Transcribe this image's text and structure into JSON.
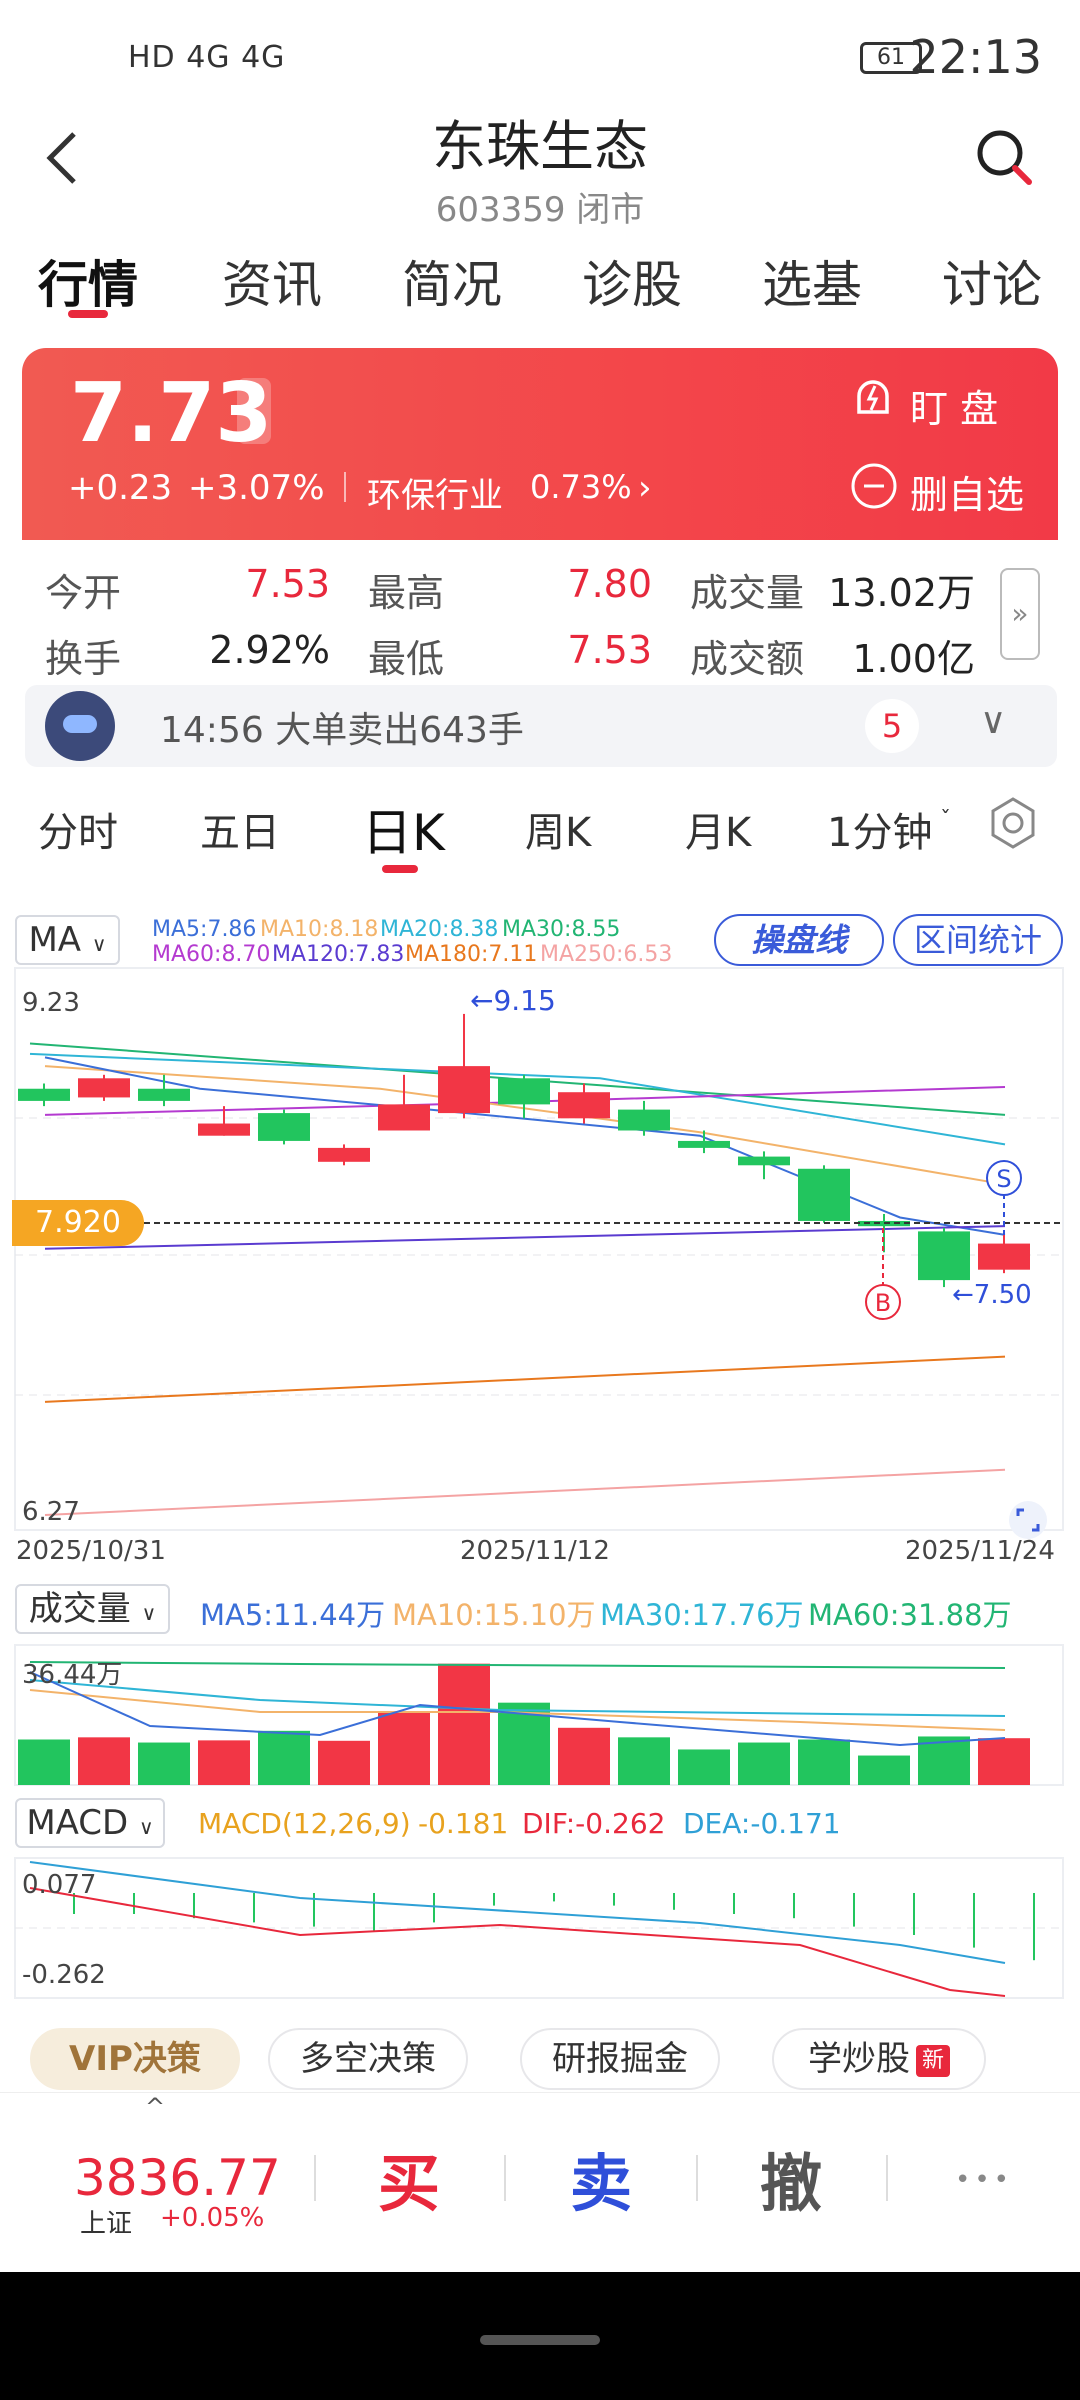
{
  "status_bar": {
    "left": "HD 4G 4G",
    "battery": "61",
    "time": "22:13"
  },
  "header": {
    "title": "东珠生态",
    "subtitle": "603359 闭市"
  },
  "tabs": [
    "行情",
    "资讯",
    "简况",
    "诊股",
    "选基",
    "讨论"
  ],
  "quote": {
    "price": "7.73",
    "change": "+0.23",
    "change_pct": "+3.07%",
    "sector": "环保行业",
    "sector_pct": "0.73%",
    "watch_label": "盯  盘",
    "fav_label": "删自选",
    "open_label": "今开",
    "open": "7.53",
    "high_label": "最高",
    "high": "7.80",
    "volume_label": "成交量",
    "volume": "13.02万",
    "turnover_label": "换手",
    "turnover": "2.92%",
    "low_label": "最低",
    "low": "7.53",
    "amount_label": "成交额",
    "amount": "1.00亿"
  },
  "news": {
    "text": "14:56 大单卖出643手",
    "count": "5"
  },
  "period_tabs": [
    "分时",
    "五日",
    "日K",
    "周K",
    "月K",
    "1分钟"
  ],
  "chart": {
    "indicator_select": "MA",
    "ma_legend": [
      {
        "text": "MA5:7.86",
        "color": "#3b6fd8"
      },
      {
        "text": "MA10:8.18",
        "color": "#f3b36a"
      },
      {
        "text": "MA20:8.38",
        "color": "#2fb5d6"
      },
      {
        "text": "MA30:8.55",
        "color": "#22b573"
      },
      {
        "text": "MA60:8.70",
        "color": "#b43ad0"
      },
      {
        "text": "MA120:7.83",
        "color": "#5a3bd0"
      },
      {
        "text": "MA180:7.11",
        "color": "#e8781e"
      },
      {
        "text": "MA250:6.53",
        "color": "#f4a3a3"
      }
    ],
    "btn_line": "操盘线",
    "btn_stats": "区间统计",
    "y_top": "9.23",
    "y_bottom": "6.27",
    "current_price_tag": "7.920",
    "max_marker": "←9.15",
    "min_marker": "←7.50",
    "buy_marker": "B",
    "sell_marker": "S",
    "dates": [
      "2025/10/31",
      "2025/11/12",
      "2025/11/24"
    ],
    "volume_select": "成交量",
    "volume_legend": [
      {
        "text": "MA5:11.44万",
        "color": "#3b6fd8"
      },
      {
        "text": "MA10:15.10万",
        "color": "#f3b36a"
      },
      {
        "text": "MA30:17.76万",
        "color": "#2fb5d6"
      },
      {
        "text": "MA60:31.88万",
        "color": "#22b573"
      }
    ],
    "volume_top": "36.44万",
    "macd_select": "MACD",
    "macd_legend": [
      {
        "text": "MACD(12,26,9)",
        "color": "#e8a21e"
      },
      {
        "text": "-0.181",
        "color": "#e8a21e"
      },
      {
        "text": "DIF:-0.262",
        "color": "#e8283c"
      },
      {
        "text": "DEA:-0.171",
        "color": "#2fa0d6"
      }
    ],
    "macd_top": "0.077",
    "macd_bottom": "-0.262"
  },
  "chart_data": {
    "type": "candlestick",
    "candles": [
      {
        "open": 8.72,
        "close": 8.65,
        "high": 8.75,
        "low": 8.62
      },
      {
        "open": 8.67,
        "close": 8.78,
        "high": 8.8,
        "low": 8.65
      },
      {
        "open": 8.72,
        "close": 8.65,
        "high": 8.8,
        "low": 8.62
      },
      {
        "open": 8.45,
        "close": 8.52,
        "high": 8.62,
        "low": 8.45
      },
      {
        "open": 8.58,
        "close": 8.42,
        "high": 8.6,
        "low": 8.4
      },
      {
        "open": 8.3,
        "close": 8.38,
        "high": 8.4,
        "low": 8.28
      },
      {
        "open": 8.48,
        "close": 8.63,
        "high": 8.8,
        "low": 8.48
      },
      {
        "open": 8.58,
        "close": 8.85,
        "high": 9.15,
        "low": 8.55
      },
      {
        "open": 8.78,
        "close": 8.63,
        "high": 8.8,
        "low": 8.55
      },
      {
        "open": 8.55,
        "close": 8.7,
        "high": 8.75,
        "low": 8.52
      },
      {
        "open": 8.6,
        "close": 8.48,
        "high": 8.65,
        "low": 8.45
      },
      {
        "open": 8.42,
        "close": 8.38,
        "high": 8.48,
        "low": 8.35
      },
      {
        "open": 8.33,
        "close": 8.28,
        "high": 8.36,
        "low": 8.2
      },
      {
        "open": 8.26,
        "close": 7.96,
        "high": 8.28,
        "low": 7.95
      },
      {
        "open": 7.96,
        "close": 7.93,
        "high": 8.0,
        "low": 7.78
      },
      {
        "open": 7.9,
        "close": 7.62,
        "high": 7.92,
        "low": 7.58
      },
      {
        "open": 7.68,
        "close": 7.83,
        "high": 7.88,
        "low": 7.66
      }
    ],
    "volume": [
      10.5,
      11.0,
      9.8,
      10.3,
      12.5,
      10.2,
      16.8,
      28.0,
      19.0,
      13.2,
      11.0,
      8.2,
      9.8,
      10.5,
      6.8,
      11.2,
      10.8
    ],
    "macd_hist": [
      -0.05,
      -0.05,
      -0.06,
      -0.07,
      -0.08,
      -0.09,
      -0.07,
      -0.03,
      -0.02,
      -0.03,
      -0.04,
      -0.05,
      -0.06,
      -0.08,
      -0.1,
      -0.13,
      -0.16
    ],
    "ylim": [
      6.27,
      9.23
    ]
  },
  "strategies": [
    "VIP决策",
    "多空决策",
    "研报掘金",
    "学炒股"
  ],
  "strategy_new": "新",
  "trade_bar": {
    "index_value": "3836.77",
    "index_name": "上证",
    "index_change": "+0.05%",
    "buy": "买",
    "sell": "卖",
    "cancel": "撤",
    "more": "•••"
  }
}
